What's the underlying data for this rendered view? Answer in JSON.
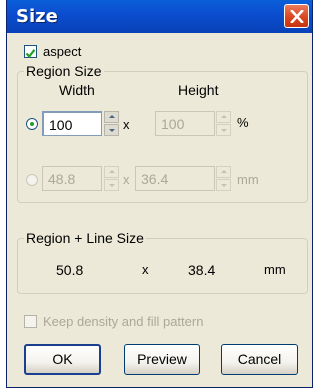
{
  "window": {
    "title": "Size"
  },
  "aspect": {
    "label": "aspect",
    "checked": true
  },
  "region_size": {
    "title": "Region Size",
    "width_header": "Width",
    "height_header": "Height",
    "percent_row": {
      "width": "100",
      "height": "100",
      "separator": "x",
      "unit": "%"
    },
    "mm_row": {
      "width": "48.8",
      "height": "36.4",
      "separator": "x",
      "unit": "mm"
    }
  },
  "region_line_size": {
    "title": "Region + Line Size",
    "width": "50.8",
    "separator": "x",
    "height": "38.4",
    "unit": "mm"
  },
  "keep_density": {
    "label": "Keep density and fill pattern",
    "checked": false,
    "enabled": false
  },
  "buttons": {
    "ok": "OK",
    "preview": "Preview",
    "cancel": "Cancel"
  }
}
